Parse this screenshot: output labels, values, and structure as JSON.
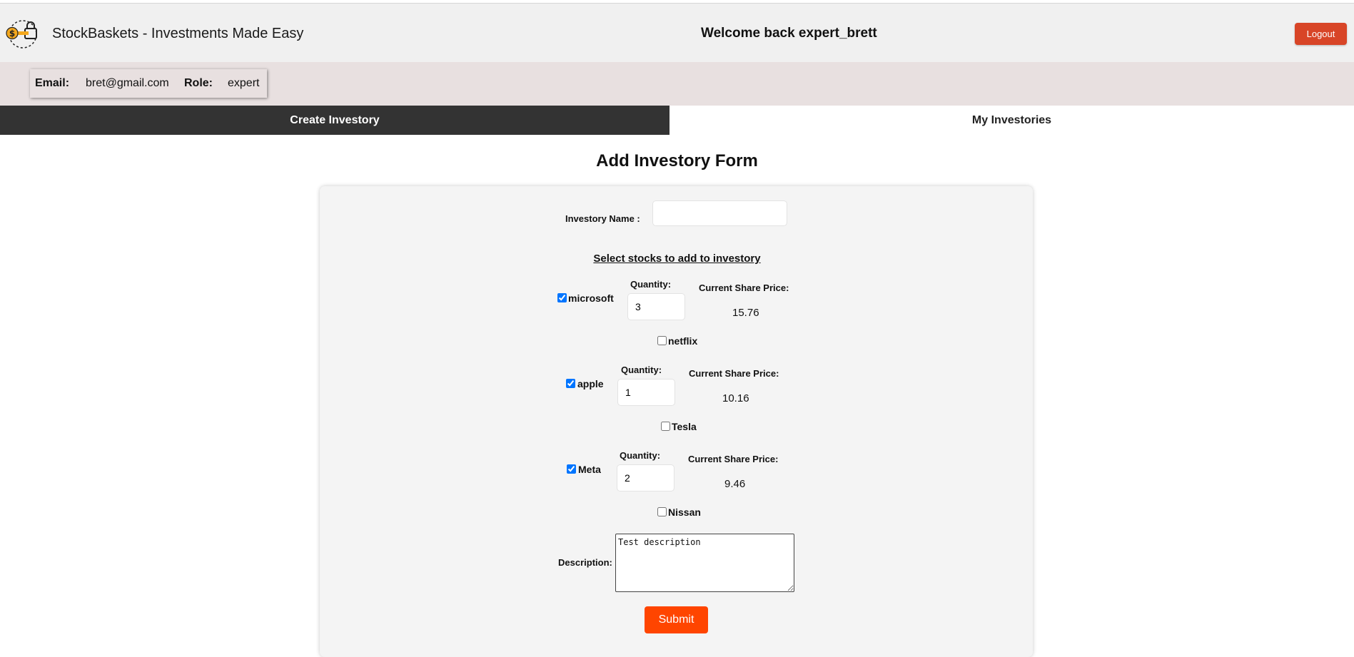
{
  "header": {
    "app_title": "StockBaskets - Investments Made Easy",
    "welcome": "Welcome back expert_brett",
    "logout_label": "Logout",
    "logo_symbol": "$"
  },
  "user_info": {
    "email_label": "Email:",
    "email_value": "bret@gmail.com",
    "role_label": "Role:",
    "role_value": "expert"
  },
  "tabs": [
    {
      "label": "Create Investory",
      "active": true
    },
    {
      "label": "My Investories",
      "active": false
    }
  ],
  "form": {
    "title": "Add Investory Form",
    "name_label": "Investory Name :",
    "name_value": "",
    "select_heading": "Select stocks to add to investory",
    "quantity_label": "Quantity:",
    "price_label": "Current Share Price:",
    "stocks": [
      {
        "name": "microsoft",
        "checked": true,
        "quantity": "3",
        "price": "15.76"
      },
      {
        "name": "netflix",
        "checked": false
      },
      {
        "name": "apple",
        "checked": true,
        "quantity": "1",
        "price": "10.16"
      },
      {
        "name": "Tesla",
        "checked": false
      },
      {
        "name": "Meta",
        "checked": true,
        "quantity": "2",
        "price": "9.46"
      },
      {
        "name": "Nissan",
        "checked": false
      }
    ],
    "description_label": "Description:",
    "description_value": "Test description",
    "submit_label": "Submit"
  },
  "colors": {
    "logout_bg": "#d84527",
    "submit_bg": "#ff4500",
    "active_tab_bg": "#333333",
    "infobar_bg": "#e8e0e0"
  }
}
